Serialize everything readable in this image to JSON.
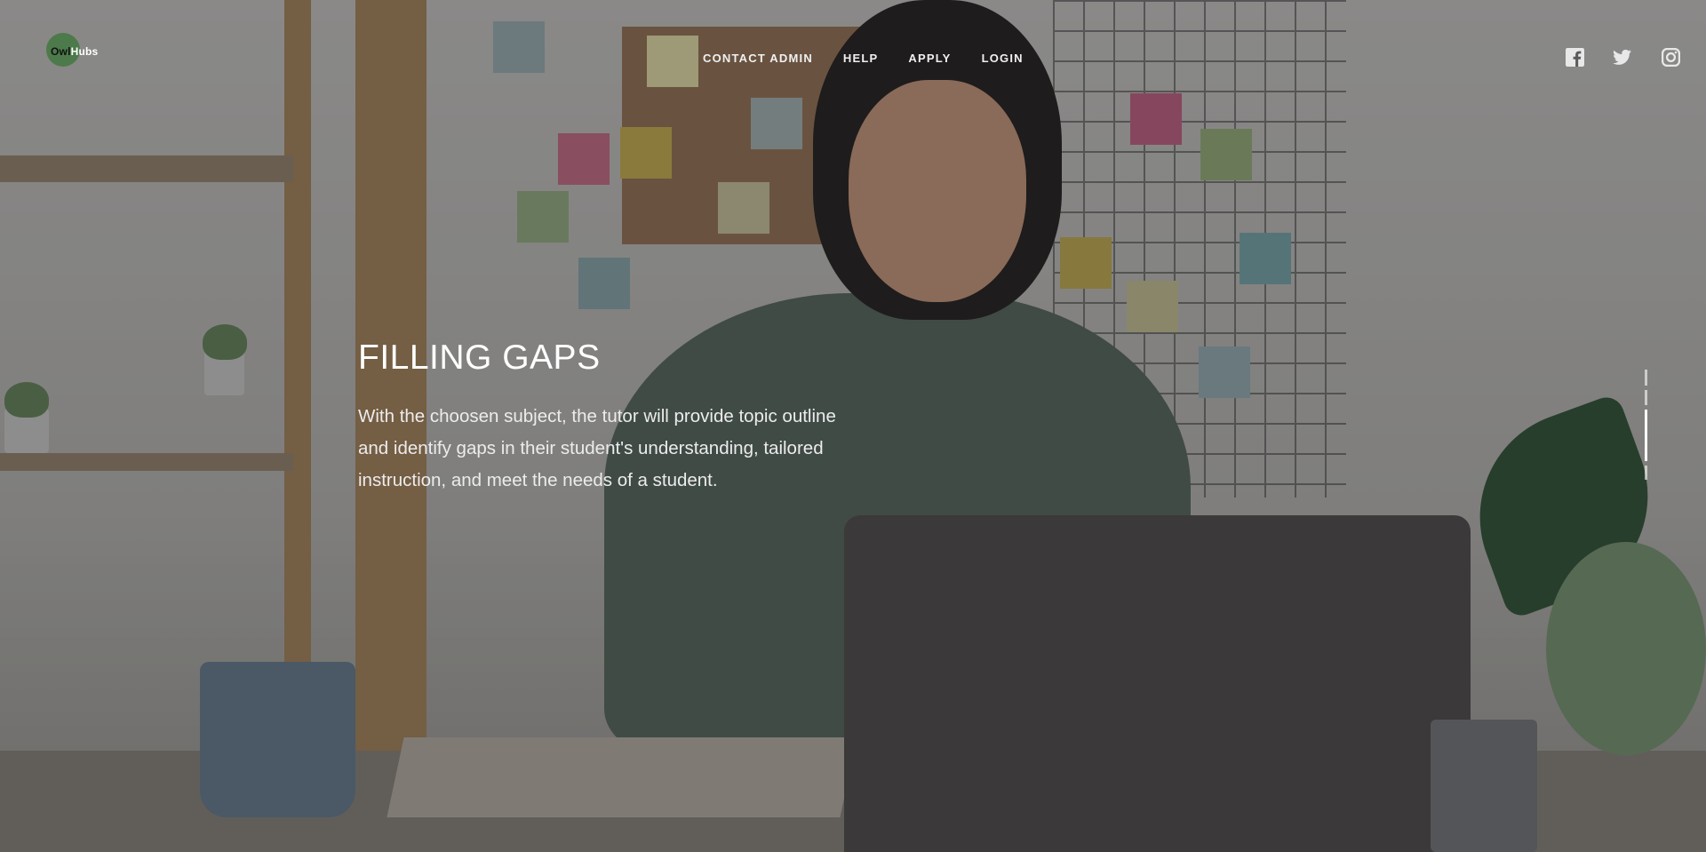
{
  "brand": {
    "logo_part1": "Owl",
    "logo_part2": "Hubs",
    "circle_color": "#4d7a4a"
  },
  "nav": {
    "items": [
      {
        "label": "CONTACT ADMIN"
      },
      {
        "label": "HELP"
      },
      {
        "label": "APPLY"
      },
      {
        "label": "LOGIN"
      }
    ]
  },
  "social": {
    "icons": [
      "facebook-icon",
      "twitter-icon",
      "instagram-icon"
    ]
  },
  "hero": {
    "title": "FILLING GAPS",
    "description": "With the choosen subject, the tutor will provide topic outline and identify gaps in their student's understanding, tailored instruction, and meet the needs of a student."
  },
  "slides": {
    "count": 4,
    "active_index": 2
  },
  "colors": {
    "text": "#ffffff",
    "overlay": "rgba(30,30,30,0.30)"
  }
}
